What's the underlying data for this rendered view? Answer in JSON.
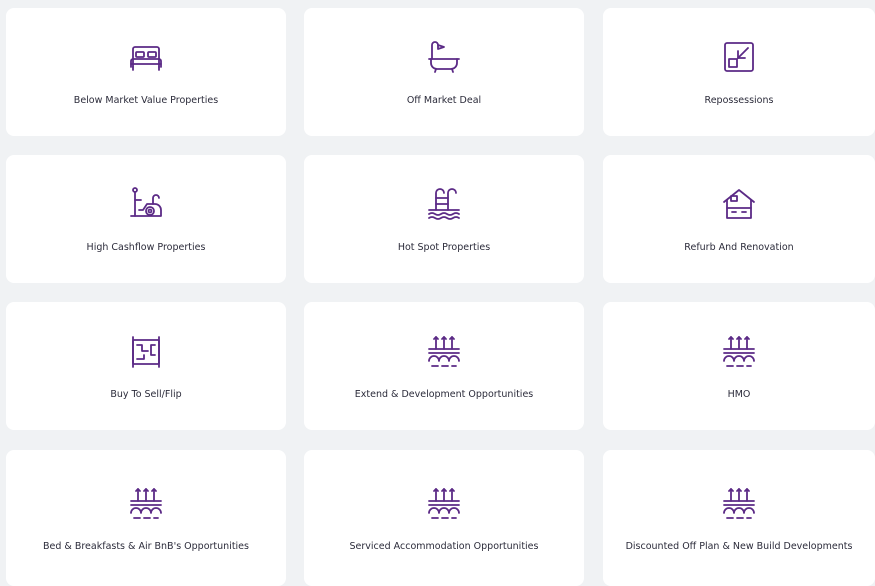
{
  "cards": [
    {
      "label": "Below Market Value Properties",
      "icon": "bed-icon"
    },
    {
      "label": "Off Market Deal",
      "icon": "bathtub-icon"
    },
    {
      "label": "Repossessions",
      "icon": "arrow-in-square-icon"
    },
    {
      "label": "High Cashflow Properties",
      "icon": "cashflow-machine-icon"
    },
    {
      "label": "Hot Spot Properties",
      "icon": "pool-ladder-icon"
    },
    {
      "label": "Refurb And Renovation",
      "icon": "house-icon"
    },
    {
      "label": "Buy To Sell/Flip",
      "icon": "blueprint-icon"
    },
    {
      "label": "Extend & Development Opportunities",
      "icon": "bridge-icon"
    },
    {
      "label": "HMO",
      "icon": "bridge-icon"
    },
    {
      "label": "Bed & Breakfasts & Air BnB's Opportunities",
      "icon": "bridge-icon"
    },
    {
      "label": "Serviced Accommodation Opportunities",
      "icon": "bridge-icon"
    },
    {
      "label": "Discounted Off Plan & New Build Developments",
      "icon": "bridge-icon"
    }
  ],
  "colors": {
    "accent": "#5b2a86",
    "background": "#f0f2f4",
    "card": "#ffffff",
    "text": "#2b2b3a"
  }
}
